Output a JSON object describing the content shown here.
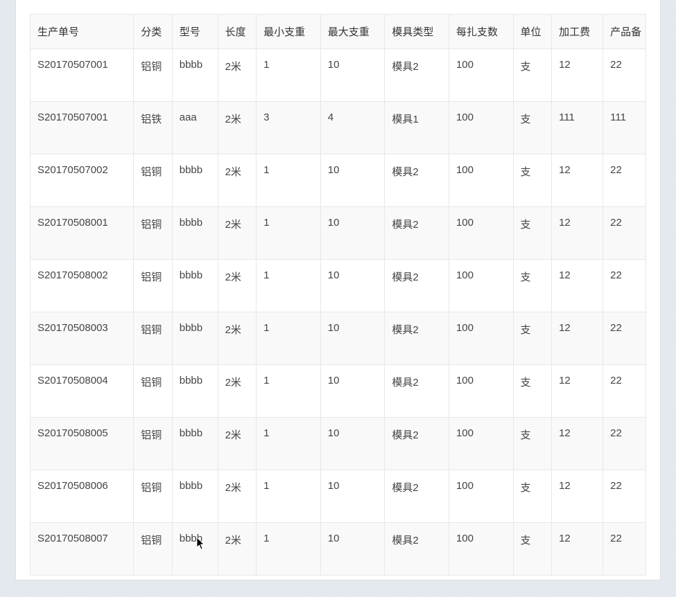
{
  "columns": [
    "生产单号",
    "分类",
    "型号",
    "长度",
    "最小支重",
    "最大支重",
    "模具类型",
    "每扎支数",
    "单位",
    "加工费",
    "产品备"
  ],
  "rows": [
    [
      "S20170507001",
      "铝铜",
      "bbbb",
      "2米",
      "1",
      "10",
      "模具2",
      "100",
      "支",
      "12",
      "22"
    ],
    [
      "S20170507001",
      "铝铁",
      "aaa",
      "2米",
      "3",
      "4",
      "模具1",
      "100",
      "支",
      "111",
      "111"
    ],
    [
      "S20170507002",
      "铝铜",
      "bbbb",
      "2米",
      "1",
      "10",
      "模具2",
      "100",
      "支",
      "12",
      "22"
    ],
    [
      "S20170508001",
      "铝铜",
      "bbbb",
      "2米",
      "1",
      "10",
      "模具2",
      "100",
      "支",
      "12",
      "22"
    ],
    [
      "S20170508002",
      "铝铜",
      "bbbb",
      "2米",
      "1",
      "10",
      "模具2",
      "100",
      "支",
      "12",
      "22"
    ],
    [
      "S20170508003",
      "铝铜",
      "bbbb",
      "2米",
      "1",
      "10",
      "模具2",
      "100",
      "支",
      "12",
      "22"
    ],
    [
      "S20170508004",
      "铝铜",
      "bbbb",
      "2米",
      "1",
      "10",
      "模具2",
      "100",
      "支",
      "12",
      "22"
    ],
    [
      "S20170508005",
      "铝铜",
      "bbbb",
      "2米",
      "1",
      "10",
      "模具2",
      "100",
      "支",
      "12",
      "22"
    ],
    [
      "S20170508006",
      "铝铜",
      "bbbb",
      "2米",
      "1",
      "10",
      "模具2",
      "100",
      "支",
      "12",
      "22"
    ],
    [
      "S20170508007",
      "铝铜",
      "bbbb",
      "2米",
      "1",
      "10",
      "模具2",
      "100",
      "支",
      "12",
      "22"
    ]
  ]
}
